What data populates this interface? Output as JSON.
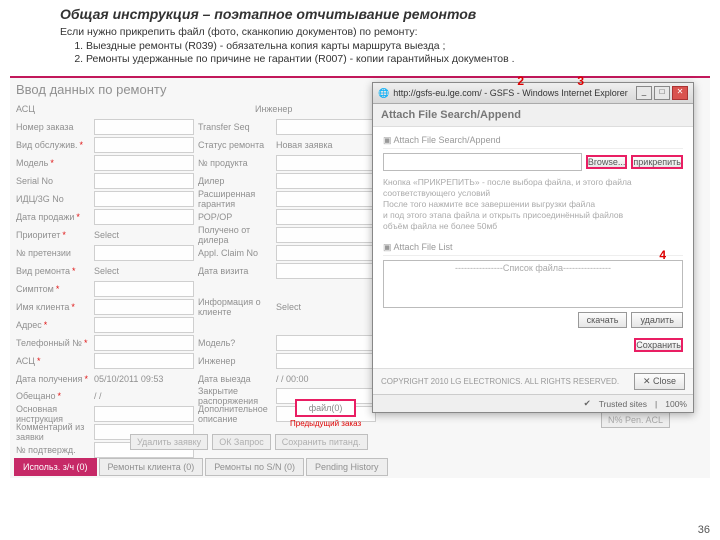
{
  "header": {
    "title": "Общая инструкция – поэтапное отчитывание ремонтов",
    "intro": "Если нужно прикрепить файл (фото, сканкопию документов) по ремонту:",
    "items": [
      "Выездные ремонты (R039) - обязательна копия карты маршрута выезда ;",
      "Ремонты удержанные по причине не гарантии (R007) - копии гарантийных документов ."
    ]
  },
  "bg": {
    "title": "Ввод данных по ремонту",
    "info1": "АСЦ",
    "info2": "Инженер",
    "labels": {
      "l1": "Номер заказа",
      "l2": "Transfer Seq",
      "l3": "Вид обслужив.",
      "l4": "Статус ремонта",
      "v4": "Новая заявка",
      "l5": "Модель",
      "l6": "№ продукта",
      "l7": "Serial No",
      "l8": "Дилер",
      "l9": "ИДЦ/3G No",
      "l10": "Расширенная гарантия",
      "l11": "Дата продажи",
      "l12": "РОР/ОР",
      "l13": "Приоритет",
      "v13": "Select",
      "l14": "Получено от дилера",
      "l15": "№ претензии",
      "l16": "Appl. Claim No",
      "l17": "Вид ремонта",
      "v17": "Select",
      "l18": "Дата визита",
      "l19": "Симптом",
      "l20": "Имя клиента",
      "l20b": "Информация о клиенте",
      "v20b": "Select",
      "l21": "Адрес",
      "l22": "Телефонный №",
      "l23": "Модель?",
      "l24": "АСЦ",
      "l25": "Инженер",
      "l26": "Дата получения",
      "v26": "05/10/2011",
      "v26t": "09:53",
      "l27": "Дата выезда",
      "v27": "/ /",
      "v27t": "00:00",
      "l28": "Обещано",
      "v28": "/ /",
      "l29": "Закрытие распоряжения",
      "l30": "Основная инструкция",
      "l31": "Дополнительное описание",
      "l32": "Комментарий из заявки",
      "l33": "№ подтвержд."
    }
  },
  "popup": {
    "url": "http://gsfs-eu.lge.com/ - GSFS - Windows Internet Explorer",
    "header": "Attach File Search/Append",
    "sec1": "Attach File Search/Append",
    "browse": "Browse...",
    "attach": "прикрепить",
    "hint1": "Кнопка «ПРИКРЕПИТЬ» - после выбора файла, и этого файла соответствующего условий",
    "hint2": "После того нажмите все завершении выгрузки файла",
    "hint3": "и под этого этапа файла и открыть присоединённый файлов",
    "hint4": "объём файла не более 50мб",
    "sec2": "Attach File List",
    "listph": "----------------Список файла----------------",
    "download": "скачать",
    "delete": "удалить",
    "save": "Сохранить",
    "copyright": "COPYRIGHT 2010 LG ELECTRONICS. ALL RIGHTS RESERVED.",
    "close": "Close",
    "trusted": "Trusted sites",
    "zoom": "100%"
  },
  "annots": {
    "a2": "2",
    "a3": "3",
    "a4": "4"
  },
  "mid": {
    "file": "файл(0)",
    "prev": "Предыдущий заказ",
    "right": "N% Pen. ACL"
  },
  "tabs": {
    "t1": "Использ. з/ч (0)",
    "t2": "Ремонты клиента (0)",
    "t3": "Ремонты по S/N (0)",
    "t4": "Pending History"
  },
  "bottomBtns": {
    "b1": "Удалить заявку",
    "b2": "ОК Запрос",
    "b3": "Сохранить питанд."
  },
  "page": "36"
}
